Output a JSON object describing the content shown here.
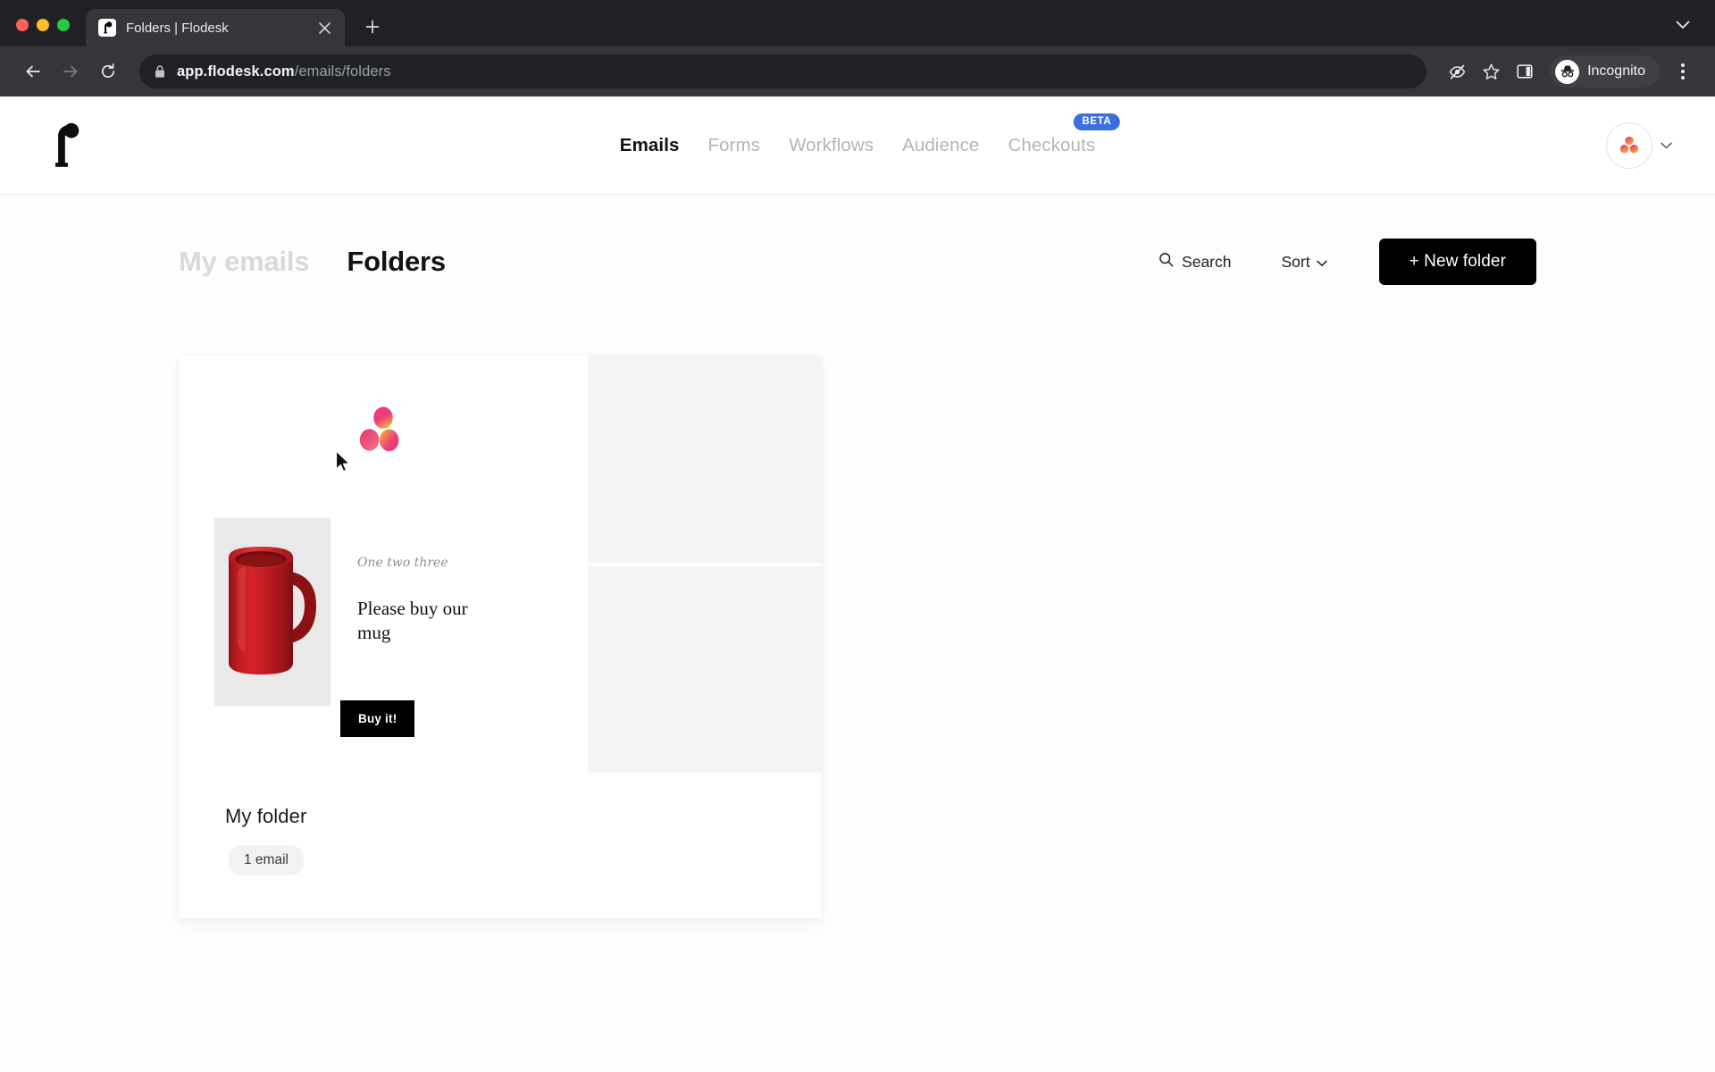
{
  "browser": {
    "tab": {
      "title": "Folders | Flodesk",
      "favicon": "flodesk-f-icon",
      "close": "×",
      "new_tab": "+"
    },
    "toolbar": {
      "back": "back-arrow-icon",
      "forward": "forward-arrow-icon",
      "reload": "reload-icon",
      "lock": "lock-icon",
      "url_host": "app.flodesk.com",
      "url_path": "/emails/folders",
      "tracking_protection": "eye-off-icon",
      "bookmark": "star-icon",
      "side_panel": "side-panel-icon",
      "profile_label": "Incognito",
      "menu": "kebab-menu-icon"
    },
    "tabstrip_chevron": "chevron-down-icon"
  },
  "app": {
    "logo": "flodesk-logo",
    "nav": [
      {
        "label": "Emails",
        "active": true,
        "badge": null
      },
      {
        "label": "Forms",
        "active": false,
        "badge": null
      },
      {
        "label": "Workflows",
        "active": false,
        "badge": null
      },
      {
        "label": "Audience",
        "active": false,
        "badge": null
      },
      {
        "label": "Checkouts",
        "active": false,
        "badge": "BETA"
      }
    ],
    "account": {
      "avatar": "flodesk-avatar",
      "chevron": "chevron-down-icon"
    }
  },
  "page": {
    "tabs": [
      {
        "label": "My emails",
        "active": false
      },
      {
        "label": "Folders",
        "active": true
      }
    ],
    "actions": {
      "search_label": "Search",
      "search_icon": "search-icon",
      "sort_label": "Sort",
      "sort_icon": "chevron-down-icon",
      "new_folder_label": "+ New folder"
    },
    "folders": [
      {
        "name": "My folder",
        "count_label": "1 email",
        "preview": {
          "logo": "flodesk-dots-logo",
          "image": "red-mug-photo",
          "script_text": "One two three",
          "body_text": "Please buy our mug",
          "cta_label": "Buy it!"
        }
      }
    ]
  },
  "colors": {
    "accent_beta": "#3b6fe0",
    "cta_black": "#000000",
    "brand_pink": "#e8407a",
    "brand_orange": "#f5a243",
    "skeleton_gray": "#f4f4f4",
    "badge_gray": "#f2f2f2"
  }
}
